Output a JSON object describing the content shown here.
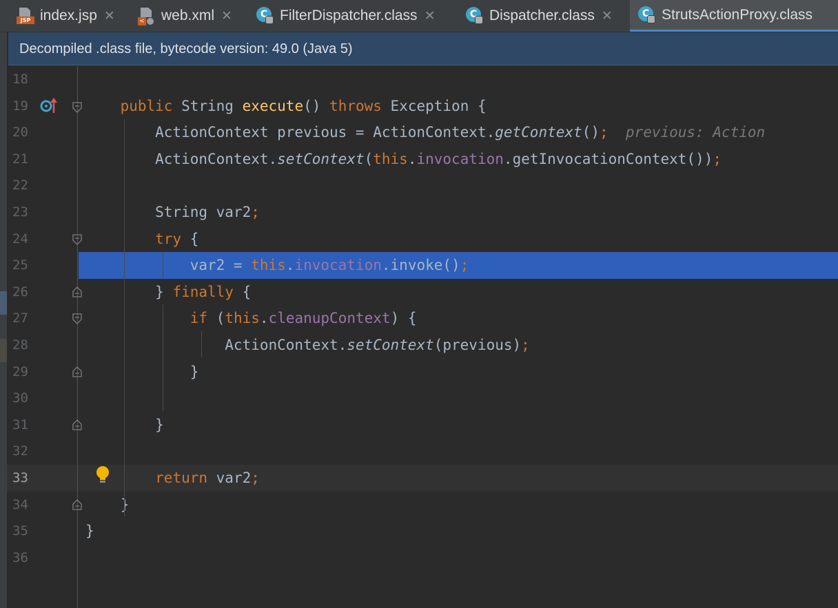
{
  "tabs": [
    {
      "label": "index.jsp",
      "icon": "jsp-file-icon"
    },
    {
      "label": "web.xml",
      "icon": "xml-file-icon"
    },
    {
      "label": "FilterDispatcher.class",
      "icon": "class-file-icon"
    },
    {
      "label": "Dispatcher.class",
      "icon": "class-file-icon"
    },
    {
      "label": "StrutsActionProxy.class",
      "icon": "class-file-icon",
      "active": true
    }
  ],
  "banner": {
    "text": "Decompiled .class file, bytecode version: 49.0 (Java 5)"
  },
  "editor": {
    "current_line": 33,
    "selected_line": 25,
    "colors": {
      "keyword": "#cc7832",
      "method": "#ffc66d",
      "field": "#9876aa",
      "text": "#a9b7c6",
      "selection": "#2f65ca"
    },
    "lines": [
      {
        "num": "18",
        "tokens": []
      },
      {
        "num": "19",
        "tokens": [
          [
            "",
            "    "
          ],
          [
            "kw",
            "public"
          ],
          [
            "",
            " String "
          ],
          [
            "fn",
            "execute"
          ],
          [
            "",
            "() "
          ],
          [
            "kw",
            "throws"
          ],
          [
            "",
            " Exception {"
          ]
        ]
      },
      {
        "num": "20",
        "tokens": [
          [
            "",
            "        ActionContext previous = ActionContext."
          ],
          [
            "it",
            "getContext"
          ],
          [
            "",
            "()"
          ],
          [
            "kw",
            ";"
          ],
          [
            "hint",
            "  previous: Action"
          ]
        ]
      },
      {
        "num": "21",
        "tokens": [
          [
            "",
            "        ActionContext."
          ],
          [
            "it",
            "setContext"
          ],
          [
            "",
            "("
          ],
          [
            "kw",
            "this"
          ],
          [
            "",
            "."
          ],
          [
            "fld",
            "invocation"
          ],
          [
            "",
            ".getInvocationContext())"
          ],
          [
            "kw",
            ";"
          ]
        ]
      },
      {
        "num": "22",
        "tokens": []
      },
      {
        "num": "23",
        "tokens": [
          [
            "",
            "        String var2"
          ],
          [
            "kw",
            ";"
          ]
        ]
      },
      {
        "num": "24",
        "tokens": [
          [
            "",
            "        "
          ],
          [
            "kw",
            "try"
          ],
          [
            "",
            " {"
          ]
        ]
      },
      {
        "num": "25",
        "tokens": [
          [
            "",
            "            var2 = "
          ],
          [
            "kw",
            "this"
          ],
          [
            "",
            "."
          ],
          [
            "fld",
            "invocation"
          ],
          [
            "",
            ".invoke()"
          ],
          [
            "kw",
            ";"
          ]
        ]
      },
      {
        "num": "26",
        "tokens": [
          [
            "",
            "        } "
          ],
          [
            "kw",
            "finally"
          ],
          [
            "",
            " {"
          ]
        ]
      },
      {
        "num": "27",
        "tokens": [
          [
            "",
            "            "
          ],
          [
            "kw",
            "if"
          ],
          [
            "",
            " ("
          ],
          [
            "kw",
            "this"
          ],
          [
            "",
            "."
          ],
          [
            "fld",
            "cleanupContext"
          ],
          [
            "",
            ") {"
          ]
        ]
      },
      {
        "num": "28",
        "tokens": [
          [
            "",
            "                ActionContext."
          ],
          [
            "it",
            "setContext"
          ],
          [
            "",
            "(previous)"
          ],
          [
            "kw",
            ";"
          ]
        ]
      },
      {
        "num": "29",
        "tokens": [
          [
            "",
            "            }"
          ]
        ]
      },
      {
        "num": "30",
        "tokens": []
      },
      {
        "num": "31",
        "tokens": [
          [
            "",
            "        }"
          ]
        ]
      },
      {
        "num": "32",
        "tokens": []
      },
      {
        "num": "33",
        "tokens": [
          [
            "",
            "        "
          ],
          [
            "kw",
            "return"
          ],
          [
            "",
            " var2"
          ],
          [
            "kw",
            ";"
          ]
        ]
      },
      {
        "num": "34",
        "tokens": [
          [
            "",
            "    }"
          ]
        ]
      },
      {
        "num": "35",
        "tokens": [
          [
            "",
            "}"
          ]
        ]
      },
      {
        "num": "36",
        "tokens": []
      }
    ]
  }
}
